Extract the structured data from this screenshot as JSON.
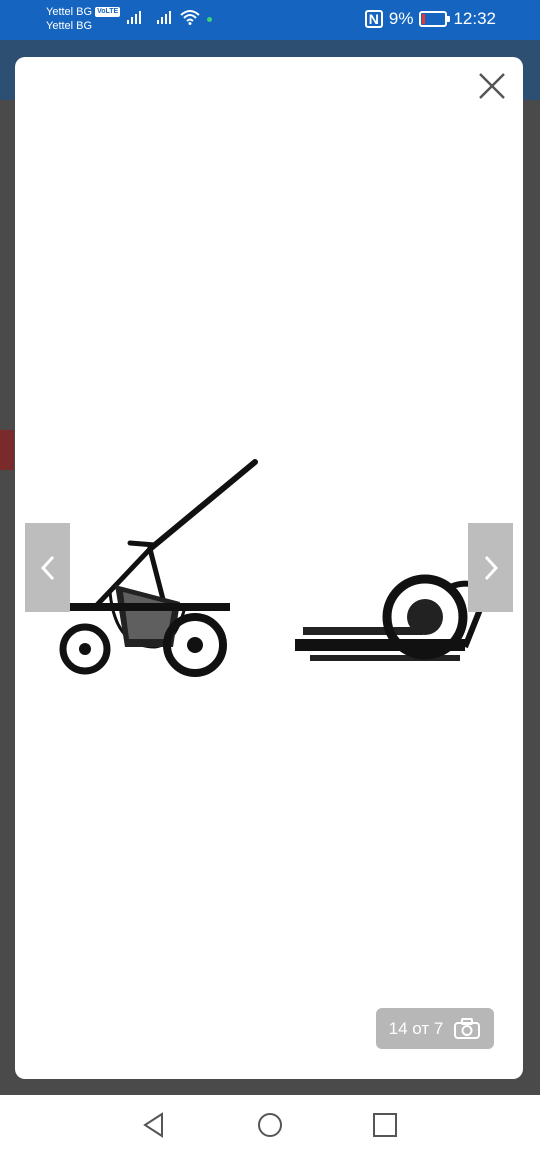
{
  "status_bar": {
    "carrier_1": "Yettel BG",
    "volte_badge": "VoLTE",
    "carrier_2": "Yettel BG",
    "nfc_label": "N",
    "battery_text": "9%",
    "battery_level": 0.09,
    "time": "12:32",
    "icons": [
      "signal-icon",
      "signal-icon",
      "wifi-icon",
      "nfc-icon",
      "battery-icon"
    ]
  },
  "gallery": {
    "counter": "14 от 7",
    "icons": [
      "close-icon",
      "chevron-left-icon",
      "chevron-right-icon",
      "camera-icon"
    ],
    "image": "stroller-frame-photo"
  },
  "navbar": {
    "icons": [
      "back-triangle-icon",
      "home-circle-icon",
      "recents-square-icon"
    ]
  },
  "colors": {
    "status_bar": "#1565c0",
    "nav_button": "#bdbdbd",
    "counter_bg": "#b7b7b7"
  }
}
